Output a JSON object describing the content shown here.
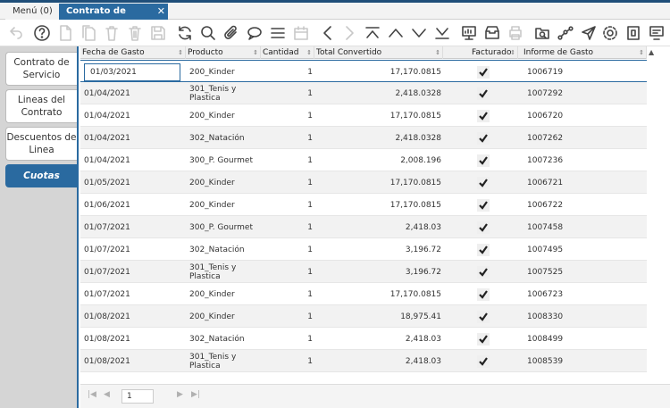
{
  "tabs": {
    "menu_label": "Menú (0)",
    "active_label": "Contrato de Servicio",
    "close_glyph": "✕"
  },
  "toolbar": {
    "icons": [
      "undo-icon",
      "help-icon",
      "new-record-icon",
      "copy-record-icon",
      "delete-icon",
      "delete-selection-icon",
      "save-icon",
      "refresh-icon",
      "search-icon",
      "attachment-icon",
      "chat-icon",
      "detail-icon",
      "calendar-icon",
      "previous-icon",
      "next-icon",
      "first-record-icon",
      "parent-record-icon",
      "child-record-icon",
      "last-record-icon",
      "report-icon",
      "archive-icon",
      "print-icon",
      "zoom-across-icon",
      "workflow-icon",
      "send-icon",
      "settings-icon",
      "export-icon",
      "process-icon"
    ]
  },
  "side_tabs": [
    {
      "label": "Contrato de Servicio",
      "active": false
    },
    {
      "label": "Lineas del Contrato",
      "active": false
    },
    {
      "label": "Descuentos de Linea",
      "active": false
    },
    {
      "label": "Cuotas",
      "active": true
    }
  ],
  "grid": {
    "columns": [
      "Fecha de Gasto",
      "Producto",
      "Cantidad",
      "Total Convertido",
      "Facturado",
      "Informe de Gasto"
    ],
    "rows": [
      {
        "fecha": "01/03/2021",
        "producto": "200_Kinder",
        "cantidad": "1",
        "total": "17,170.0815",
        "facturado": true,
        "informe": "1006719"
      },
      {
        "fecha": "01/04/2021",
        "producto": "301_Tenis y Plastica",
        "cantidad": "1",
        "total": "2,418.0328",
        "facturado": true,
        "informe": "1007292"
      },
      {
        "fecha": "01/04/2021",
        "producto": "200_Kinder",
        "cantidad": "1",
        "total": "17,170.0815",
        "facturado": true,
        "informe": "1006720"
      },
      {
        "fecha": "01/04/2021",
        "producto": "302_Natación",
        "cantidad": "1",
        "total": "2,418.0328",
        "facturado": true,
        "informe": "1007262"
      },
      {
        "fecha": "01/04/2021",
        "producto": "300_P. Gourmet",
        "cantidad": "1",
        "total": "2,008.196",
        "facturado": true,
        "informe": "1007236"
      },
      {
        "fecha": "01/05/2021",
        "producto": "200_Kinder",
        "cantidad": "1",
        "total": "17,170.0815",
        "facturado": true,
        "informe": "1006721"
      },
      {
        "fecha": "01/06/2021",
        "producto": "200_Kinder",
        "cantidad": "1",
        "total": "17,170.0815",
        "facturado": true,
        "informe": "1006722"
      },
      {
        "fecha": "01/07/2021",
        "producto": "300_P. Gourmet",
        "cantidad": "1",
        "total": "2,418.03",
        "facturado": true,
        "informe": "1007458"
      },
      {
        "fecha": "01/07/2021",
        "producto": "302_Natación",
        "cantidad": "1",
        "total": "3,196.72",
        "facturado": true,
        "informe": "1007495"
      },
      {
        "fecha": "01/07/2021",
        "producto": "301_Tenis y Plastica",
        "cantidad": "1",
        "total": "3,196.72",
        "facturado": true,
        "informe": "1007525"
      },
      {
        "fecha": "01/07/2021",
        "producto": "200_Kinder",
        "cantidad": "1",
        "total": "17,170.0815",
        "facturado": true,
        "informe": "1006723"
      },
      {
        "fecha": "01/08/2021",
        "producto": "200_Kinder",
        "cantidad": "1",
        "total": "18,975.41",
        "facturado": true,
        "informe": "1008330"
      },
      {
        "fecha": "01/08/2021",
        "producto": "302_Natación",
        "cantidad": "1",
        "total": "2,418.03",
        "facturado": true,
        "informe": "1008499"
      },
      {
        "fecha": "01/08/2021",
        "producto": "301_Tenis y Plastica",
        "cantidad": "1",
        "total": "2,418.03",
        "facturado": true,
        "informe": "1008539"
      }
    ]
  },
  "paging": {
    "current_page": "1"
  },
  "colors": {
    "accent": "#2a6aa0",
    "topbar": "#1f4e79"
  }
}
